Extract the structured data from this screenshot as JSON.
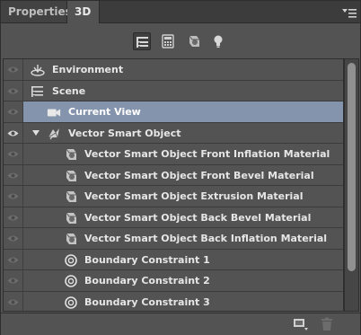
{
  "tabs": [
    {
      "label": "Properties",
      "active": false
    },
    {
      "label": "3D",
      "active": true
    }
  ],
  "panel_menu": {
    "icon": "panel-menu-icon"
  },
  "filters": [
    {
      "icon": "whole-scene-icon",
      "selected": true
    },
    {
      "icon": "meshes-icon",
      "selected": false
    },
    {
      "icon": "materials-icon",
      "selected": false
    },
    {
      "icon": "lights-icon",
      "selected": false
    }
  ],
  "layers": [
    {
      "label": "Environment",
      "icon": "environment-icon",
      "visible": true,
      "indent": 0,
      "selected": false
    },
    {
      "label": "Scene",
      "icon": "scene-icon",
      "visible": true,
      "indent": 0,
      "selected": false
    },
    {
      "label": "Current View",
      "icon": "camera-icon",
      "visible": true,
      "indent": 1,
      "selected": true
    },
    {
      "label": "Vector Smart Object",
      "icon": "mesh-icon",
      "visible": true,
      "indent": 1,
      "expanded": true,
      "selected": false
    },
    {
      "label": "Vector Smart Object Front Inflation Material",
      "icon": "material-icon",
      "visible": true,
      "indent": 2,
      "selected": false
    },
    {
      "label": "Vector Smart Object Front Bevel Material",
      "icon": "material-icon",
      "visible": true,
      "indent": 2,
      "selected": false
    },
    {
      "label": "Vector Smart Object Extrusion Material",
      "icon": "material-icon",
      "visible": true,
      "indent": 2,
      "selected": false
    },
    {
      "label": "Vector Smart Object Back Bevel Material",
      "icon": "material-icon",
      "visible": true,
      "indent": 2,
      "selected": false
    },
    {
      "label": "Vector Smart Object Back Inflation Material",
      "icon": "material-icon",
      "visible": true,
      "indent": 2,
      "selected": false
    },
    {
      "label": "Boundary Constraint 1",
      "icon": "constraint-icon",
      "visible": true,
      "indent": 2,
      "selected": false
    },
    {
      "label": "Boundary Constraint 2",
      "icon": "constraint-icon",
      "visible": true,
      "indent": 2,
      "selected": false
    },
    {
      "label": "Boundary Constraint 3",
      "icon": "constraint-icon",
      "visible": true,
      "indent": 2,
      "selected": false
    }
  ],
  "bottom_bar": [
    {
      "icon": "add-object-icon"
    },
    {
      "icon": "delete-icon"
    }
  ],
  "colors": {
    "panel_bg": "#535353",
    "selection": "#8594ad",
    "text": "#e6e6e6"
  }
}
